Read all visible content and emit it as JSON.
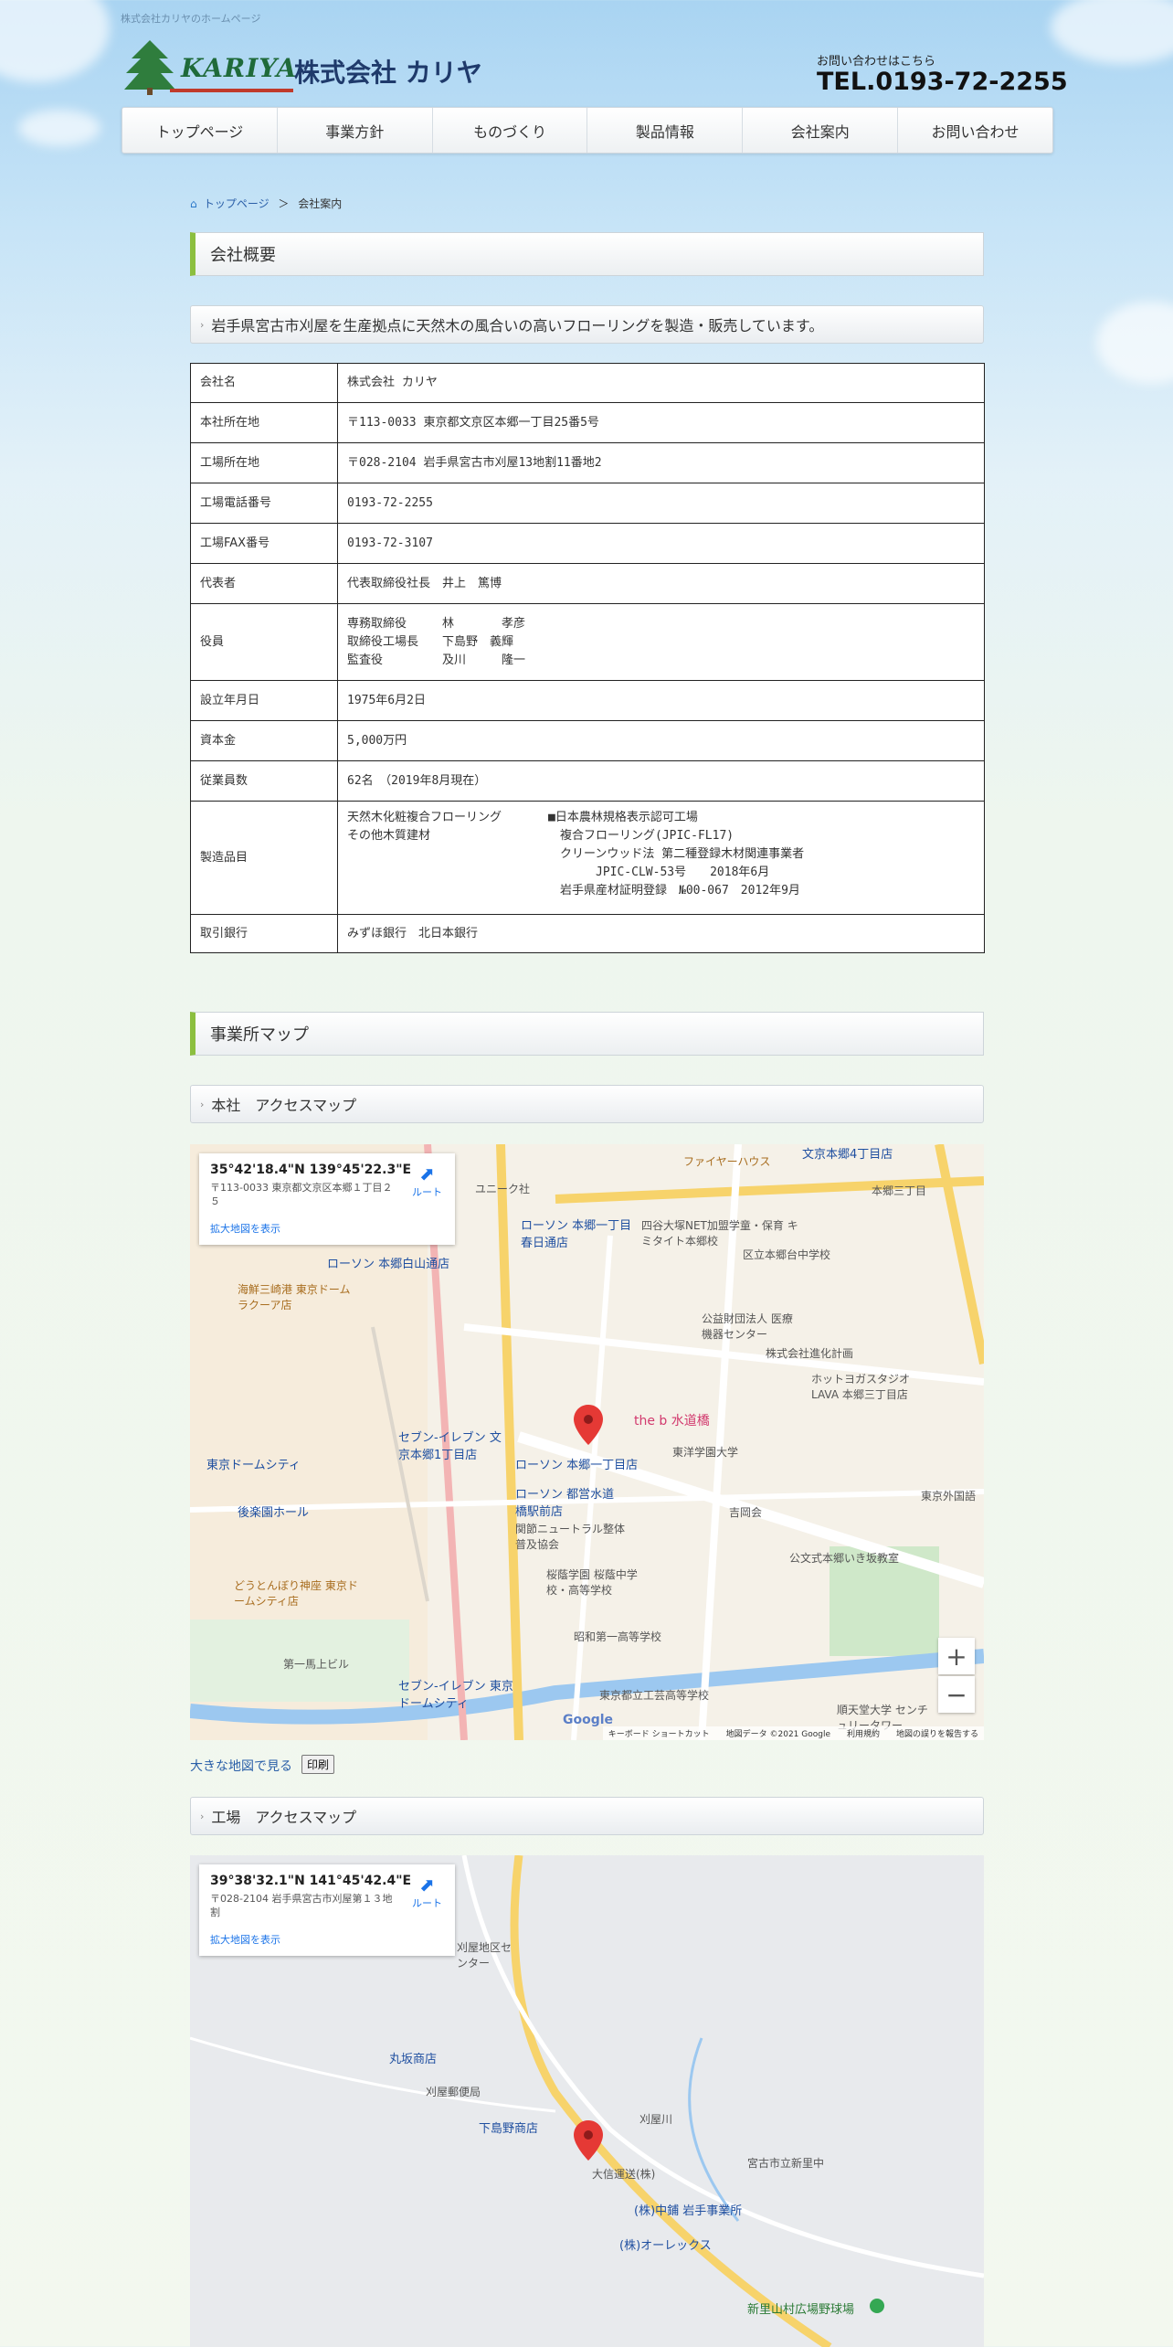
{
  "site": {
    "top_note": "株式会社カリヤのホームページ",
    "logo_en": "KARIYA",
    "logo_jp": "株式会社 カリヤ",
    "contact_note": "お問い合わせはこちら",
    "contact_tel": "TEL.0193-72-2255"
  },
  "nav": [
    "トップページ",
    "事業方針",
    "ものづくり",
    "製品情報",
    "会社案内",
    "お問い合わせ"
  ],
  "breadcrumb": {
    "home": "トップページ",
    "sep": "＞",
    "current": "会社案内"
  },
  "company": {
    "heading": "会社概要",
    "tagline": "岩手県宮古市刈屋を生産拠点に天然木の風合いの高いフローリングを製造・販売しています。",
    "rows": [
      {
        "key": "会社名",
        "value": "株式会社 カリヤ"
      },
      {
        "key": "本社所在地",
        "value": "〒113-0033 東京都文京区本郷一丁目25番5号"
      },
      {
        "key": "工場所在地",
        "value": "〒028-2104 岩手県宮古市刈屋13地割11番地2"
      },
      {
        "key": "工場電話番号",
        "value": "0193-72-2255"
      },
      {
        "key": "工場FAX番号",
        "value": "0193-72-3107"
      },
      {
        "key": "代表者",
        "value": "代表取締役社長　井上　篤博"
      },
      {
        "key": "役員",
        "value": "専務取締役　　　林　　　　孝彦\n取締役工場長　　下島野　義輝\n監査役　　　　　及川　　　隆一"
      },
      {
        "key": "設立年月日",
        "value": "1975年6月2日"
      },
      {
        "key": "資本金",
        "value": "5,000万円"
      },
      {
        "key": "従業員数",
        "value": "62名　（2019年8月現在）"
      },
      {
        "key": "製造品目",
        "value": "天然木化粧複合フローリング\nその他木質建材",
        "value2": "■日本農林規格表示認可工場\n　複合フローリング(JPIC-FL17)\n　クリーンウッド法 第二種登録木材関連事業者\n　　　　JPIC-CLW-53号　　2018年6月\n　岩手県産材証明登録　№00-067　2012年9月"
      },
      {
        "key": "取引銀行",
        "value": "みずほ銀行　北日本銀行"
      }
    ]
  },
  "offices": {
    "heading": "事業所マップ",
    "hq_heading": "本社　アクセスマップ",
    "factory_heading": "工場　アクセスマップ",
    "hq_map": {
      "coord": "35°42'18.4\"N 139°45'22.3\"E",
      "address": "〒113-0033 東京都文京区本郷１丁目２５",
      "route": "ルート",
      "enlarge": "拡大地図を表示",
      "attribution": "キーボード ショートカット　　地図データ ©2021 Google　　利用規約　　地図の誤りを報告する",
      "google": "Google",
      "labels": [
        {
          "t": "ファイヤーハウス",
          "c": "brown"
        },
        {
          "t": "文京本郷4丁目店",
          "c": "blue"
        },
        {
          "t": "本郷三丁目",
          "c": "gray"
        },
        {
          "t": "ユニーク社",
          "c": "gray"
        },
        {
          "t": "四谷大塚NET加盟学童・保育 キミタイト本郷校",
          "c": "gray"
        },
        {
          "t": "ローソン 本郷一丁目春日通店",
          "c": "blue"
        },
        {
          "t": "区立本郷台中学校",
          "c": "gray"
        },
        {
          "t": "ローソン 本郷白山通店",
          "c": "blue"
        },
        {
          "t": "海鮮三崎港 東京ドームラクーア店",
          "c": "brown"
        },
        {
          "t": "公益財団法人 医療機器センター",
          "c": "gray"
        },
        {
          "t": "株式会社進化計画",
          "c": "gray"
        },
        {
          "t": "ホットヨガスタジオLAVA 本郷三丁目店",
          "c": "gray"
        },
        {
          "t": "the b 水道橋",
          "c": "pink"
        },
        {
          "t": "セブン-イレブン 文京本郷1丁目店",
          "c": "blue"
        },
        {
          "t": "ローソン 本郷一丁目店",
          "c": "blue"
        },
        {
          "t": "東京ドームシティ",
          "c": "blue"
        },
        {
          "t": "後楽園ホール",
          "c": "blue"
        },
        {
          "t": "東洋学園大学",
          "c": "gray"
        },
        {
          "t": "ローソン 都営水道橋駅前店",
          "c": "blue"
        },
        {
          "t": "関節ニュートラル整体普及協会",
          "c": "gray"
        },
        {
          "t": "吉岡会",
          "c": "gray"
        },
        {
          "t": "公文式本郷いき坂教室",
          "c": "gray"
        },
        {
          "t": "どうとんぼり神座 東京ドームシティ店",
          "c": "brown"
        },
        {
          "t": "桜蔭学園 桜蔭中学校・高等学校",
          "c": "gray"
        },
        {
          "t": "昭和第一高等学校",
          "c": "gray"
        },
        {
          "t": "東京都立工芸高等学校",
          "c": "gray"
        },
        {
          "t": "順天堂大学 センチュリータワー",
          "c": "gray"
        },
        {
          "t": "セブン-イレブン 東京ドームシティ",
          "c": "blue"
        },
        {
          "t": "第一馬上ビル",
          "c": "gray"
        },
        {
          "t": "東京外国語",
          "c": "gray"
        }
      ]
    },
    "factory_map": {
      "coord": "39°38'32.1\"N 141°45'42.4\"E",
      "address": "〒028-2104 岩手県宮古市刈屋第１３地割",
      "route": "ルート",
      "enlarge": "拡大地図を表示",
      "labels": [
        {
          "t": "刈屋地区センター",
          "c": "gray"
        },
        {
          "t": "丸坂商店",
          "c": "blue"
        },
        {
          "t": "刈屋郵便局",
          "c": "gray"
        },
        {
          "t": "下島野商店",
          "c": "blue"
        },
        {
          "t": "大信運送(株)",
          "c": "gray"
        },
        {
          "t": "宮古市立新里中",
          "c": "gray"
        },
        {
          "t": "(株)中鋪 岩手事業所",
          "c": "blue"
        },
        {
          "t": "(株)オーレックス",
          "c": "blue"
        },
        {
          "t": "新里山村広場野球場",
          "c": "green"
        },
        {
          "t": "刈屋川",
          "c": "gray"
        }
      ]
    },
    "map_link": "大きな地図で見る",
    "print_button": "印刷"
  }
}
